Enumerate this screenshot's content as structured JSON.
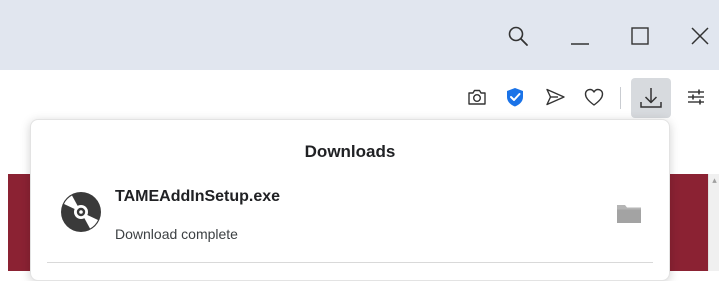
{
  "window_controls": {
    "search": "search-icon",
    "minimize": "minimize-icon",
    "maximize": "maximize-icon",
    "close": "close-icon"
  },
  "toolbar": {
    "icons": [
      "camera-icon",
      "shield-icon",
      "send-icon",
      "heart-icon",
      "download-icon",
      "settings-sliders-icon"
    ],
    "shield_color": "#1a73e8"
  },
  "downloads": {
    "title": "Downloads",
    "items": [
      {
        "file_name": "TAMEAddInSetup.exe",
        "status": "Download complete",
        "icon": "disc-icon",
        "action_icon": "folder-icon"
      }
    ]
  },
  "colors": {
    "titlebar": "#e1e6ef",
    "page_accent": "#8b2233"
  }
}
